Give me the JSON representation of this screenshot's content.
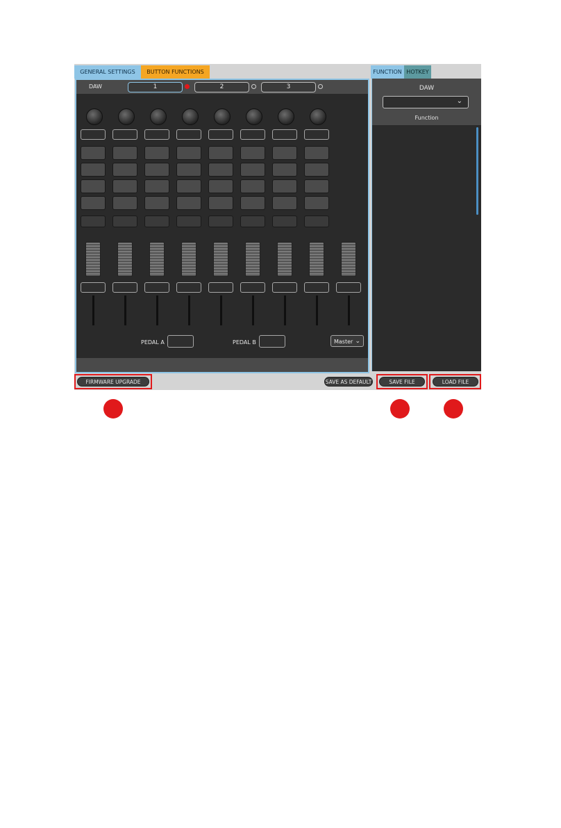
{
  "tabs": {
    "general_settings": "GENERAL SETTINGS",
    "button_functions": "BUTTON FUNCTIONS",
    "function": "FUNCTION",
    "hotkey": "HOTKEY"
  },
  "daw_bar": {
    "label": "DAW",
    "layers": [
      "1",
      "2",
      "3"
    ],
    "active_layer": "1"
  },
  "pedals": {
    "a_label": "PEDAL A",
    "b_label": "PEDAL B"
  },
  "master_select": {
    "value": "Master"
  },
  "side_panel": {
    "daw_label": "DAW",
    "daw_select_value": "",
    "function_label": "Function"
  },
  "footer": {
    "firmware_upgrade": "FIRMWARE UPGRADE",
    "save_as_default": "SAVE AS DEFAULT",
    "save_file": "SAVE FILE",
    "load_file": "LOAD FILE"
  },
  "colors": {
    "accent_blue": "#8ec5e6",
    "accent_orange": "#f5a623",
    "hotkey_teal": "#5d9aa0",
    "highlight_red": "#e0191b",
    "panel_dark": "#2a2a2a"
  },
  "icons": {
    "select_chevron": "chevron-down-icon",
    "layer_indicator": "status-dot-icon",
    "callout": "callout-circle"
  }
}
